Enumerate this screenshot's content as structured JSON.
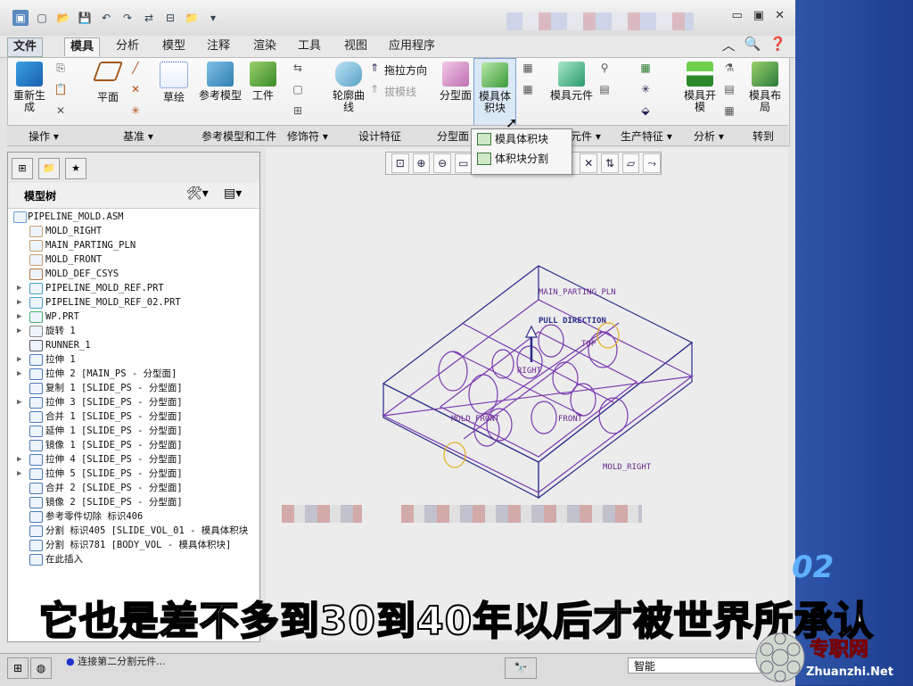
{
  "menu": {
    "tabs": [
      "文件",
      "模具",
      "分析",
      "模型",
      "注释",
      "渲染",
      "工具",
      "视图",
      "应用程序"
    ]
  },
  "ribbon": {
    "buttons": {
      "regen": "重新生成",
      "plane": "平面",
      "sketch": "草绘",
      "ref_model": "参考模型",
      "workpiece": "工件",
      "profile_curve": "轮廓曲线",
      "drag_direction": "拖拉方向",
      "draft_line": "拔模线",
      "parting_surface": "分型面",
      "mold_volume": "模具体积块",
      "mold_component": "模具元件",
      "mold_open": "模具开模",
      "mold_layout": "模具布局"
    },
    "groups": [
      "操作",
      "基准",
      "参考模型和工件",
      "修饰符",
      "设计特征",
      "分型面",
      "元件",
      "生产特征",
      "分析",
      "转到"
    ]
  },
  "dropdown": {
    "items": [
      "模具体积块",
      "体积块分割"
    ]
  },
  "model_tree": {
    "title": "模型树",
    "items": [
      {
        "label": "PIPELINE_MOLD.ASM",
        "indent": 0,
        "expand": ""
      },
      {
        "label": "MOLD_RIGHT",
        "indent": 1,
        "expand": ""
      },
      {
        "label": "MAIN_PARTING_PLN",
        "indent": 1,
        "expand": ""
      },
      {
        "label": "MOLD_FRONT",
        "indent": 1,
        "expand": ""
      },
      {
        "label": "MOLD_DEF_CSYS",
        "indent": 1,
        "expand": ""
      },
      {
        "label": "PIPELINE_MOLD_REF.PRT",
        "indent": 1,
        "expand": "▶"
      },
      {
        "label": "PIPELINE_MOLD_REF_02.PRT",
        "indent": 1,
        "expand": "▶"
      },
      {
        "label": "WP.PRT",
        "indent": 1,
        "expand": "▶"
      },
      {
        "label": "旋转 1",
        "indent": 1,
        "expand": "▶"
      },
      {
        "label": "RUNNER_1",
        "indent": 1,
        "expand": ""
      },
      {
        "label": "拉伸 1",
        "indent": 1,
        "expand": "▶"
      },
      {
        "label": "拉伸 2 [MAIN_PS - 分型面]",
        "indent": 1,
        "expand": "▶"
      },
      {
        "label": "复制 1 [SLIDE_PS - 分型面]",
        "indent": 1,
        "expand": ""
      },
      {
        "label": "拉伸 3 [SLIDE_PS - 分型面]",
        "indent": 1,
        "expand": "▶"
      },
      {
        "label": "合并 1 [SLIDE_PS - 分型面]",
        "indent": 1,
        "expand": ""
      },
      {
        "label": "延伸 1 [SLIDE_PS - 分型面]",
        "indent": 1,
        "expand": ""
      },
      {
        "label": "镜像 1 [SLIDE_PS - 分型面]",
        "indent": 1,
        "expand": ""
      },
      {
        "label": "拉伸 4 [SLIDE_PS - 分型面]",
        "indent": 1,
        "expand": "▶"
      },
      {
        "label": "拉伸 5 [SLIDE_PS - 分型面]",
        "indent": 1,
        "expand": "▶"
      },
      {
        "label": "合并 2 [SLIDE_PS - 分型面]",
        "indent": 1,
        "expand": ""
      },
      {
        "label": "镜像 2 [SLIDE_PS - 分型面]",
        "indent": 1,
        "expand": ""
      },
      {
        "label": "参考零件切除 标识406",
        "indent": 1,
        "expand": ""
      },
      {
        "label": "分割 标识405 [SLIDE_VOL_01 - 模具体积块",
        "indent": 1,
        "expand": ""
      },
      {
        "label": "分割 标识781 [BODY_VOL - 模具体积块]",
        "indent": 1,
        "expand": ""
      },
      {
        "label": "在此插入",
        "indent": 1,
        "expand": ""
      }
    ]
  },
  "viewport": {
    "labels": [
      "MAIN_PARTING_PLN",
      "PULL DIRECTION",
      "TOP",
      "RIGHT",
      "FRONT",
      "MOLD_FRONT",
      "MOLD_RIGHT"
    ]
  },
  "status": {
    "message": "连接第二分割元件...",
    "filter": "智能"
  },
  "overlay": {
    "subtitle": "它也是差不多到30到40年以后才被世界所承认",
    "watermark_text": "专职网",
    "watermark_url": "Zhuanzhi.Net",
    "corner_text": "02"
  },
  "colors": {
    "accent_blue": "#1a3d8c",
    "wire_purple": "#7a3ab0",
    "wire_navy": "#2a2a8a",
    "highlight_yellow": "#e0b020"
  }
}
